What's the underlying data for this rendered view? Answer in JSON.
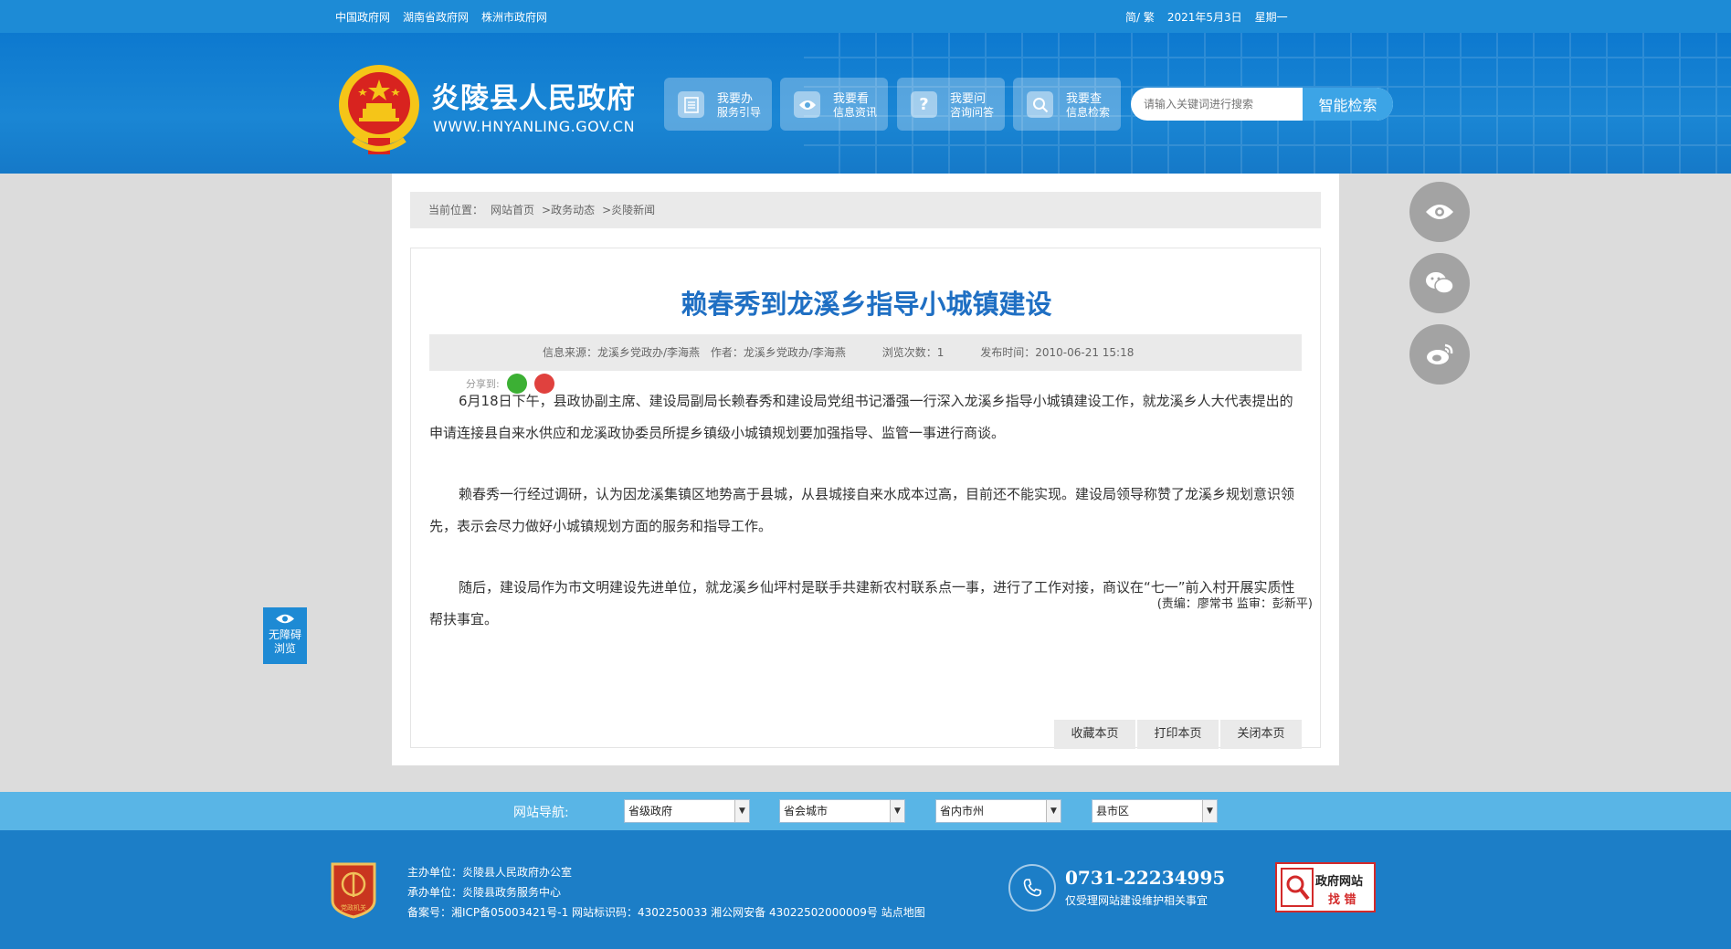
{
  "topbar": {
    "links": [
      "中国政府网",
      "湖南省政府网",
      "株洲市政府网"
    ],
    "lang": "简/ 繁",
    "date": "2021年5月3日",
    "weekday": "星期一"
  },
  "header": {
    "title": "炎陵县人民政府",
    "url": "WWW.HNYANLING.GOV.CN",
    "services": [
      {
        "icon": "doc-icon",
        "title": "我要办",
        "sub": "服务引导"
      },
      {
        "icon": "eye-icon",
        "title": "我要看",
        "sub": "信息资讯"
      },
      {
        "icon": "question-icon",
        "title": "我要问",
        "sub": "咨询问答"
      },
      {
        "icon": "search-icon",
        "title": "我要查",
        "sub": "信息检索"
      }
    ],
    "search_placeholder": "请输入关键词进行搜索",
    "search_button": "智能检索"
  },
  "breadcrumb": {
    "prefix": "当前位置：",
    "items": [
      "网站首页",
      ">政务动态",
      ">炎陵新闻"
    ]
  },
  "article": {
    "title": "赖春秀到龙溪乡指导小城镇建设",
    "meta": {
      "source": "信息来源：龙溪乡党政办/李海燕",
      "author": "作者：龙溪乡党政办/李海燕",
      "views": "浏览次数：1",
      "published": "发布时间：2010-06-21 15:18"
    },
    "share_label": "分享到:",
    "paragraphs": [
      "6月18日下午，县政协副主席、建设局副局长赖春秀和建设局党组书记潘强一行深入龙溪乡指导小城镇建设工作，就龙溪乡人大代表提出的申请连接县自来水供应和龙溪政协委员所提乡镇级小城镇规划要加强指导、监管一事进行商谈。",
      "赖春秀一行经过调研，认为因龙溪集镇区地势高于县城，从县城接自来水成本过高，目前还不能实现。建设局领导称赞了龙溪乡规划意识领先，表示会尽力做好小城镇规划方面的服务和指导工作。",
      "随后，建设局作为市文明建设先进单位，就龙溪乡仙坪村是联手共建新农村联系点一事，进行了工作对接，商议在“七一”前入村开展实质性帮扶事宜。"
    ],
    "editor": "(责编：廖常书  监审：彭新平)",
    "actions": [
      "收藏本页",
      "打印本页",
      "关闭本页"
    ]
  },
  "side": {
    "access_line1": "无障碍",
    "access_line2": "浏览"
  },
  "nav": {
    "label": "网站导航:",
    "selects": [
      "省级政府",
      "省会城市",
      "省内市州",
      "县市区"
    ]
  },
  "footer": {
    "badge_text": "党政机关",
    "host": "主办单位：炎陵县人民政府办公室",
    "organizer": "承办单位：炎陵县政务服务中心",
    "record": "备案号：湘ICP备05003421号-1 网站标识码：4302250033 湘公网安备 43022502000009号 站点地图",
    "phone": "0731-22234995",
    "phone_note": "仅受理网站建设维护相关事宜",
    "fault_line1": "政府网站",
    "fault_line2": "找 错"
  },
  "colors": {
    "topbar": "#1d8bd6",
    "header": "#0d79cf",
    "title_blue": "#1f6fc3",
    "navbar": "#59b5e6",
    "footer": "#1c7ec7"
  }
}
